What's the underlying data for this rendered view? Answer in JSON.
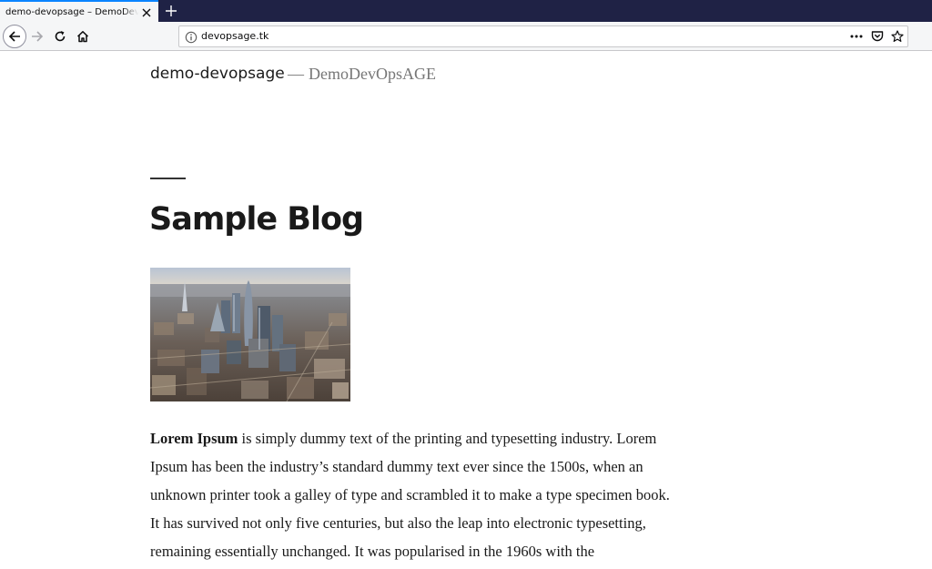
{
  "browser": {
    "tab_title": "demo-devopsage – DemoDevOpsAGE",
    "url": "devopsage.tk",
    "icons": {
      "tab_close": "close-icon",
      "new_tab": "plus-icon",
      "back": "arrow-left-icon",
      "forward": "arrow-right-icon",
      "reload": "reload-icon",
      "home": "home-icon",
      "site_info": "info-icon",
      "page_actions": "more-horizontal-icon",
      "pocket": "pocket-icon",
      "bookmark": "star-icon"
    }
  },
  "site": {
    "title": "demo-devopsage",
    "separator": "—",
    "description": "DemoDevOpsAGE"
  },
  "post": {
    "title": "Sample Blog",
    "image": "aerial-city-skyline",
    "body_bold": "Lorem Ipsum",
    "body_text": " is simply dummy text of the printing and typesetting industry. Lorem Ipsum has been the industry’s standard dummy text ever since the 1500s, when an unknown printer took a galley of type and scrambled it to make a type specimen book. It has survived not only five centuries, but also the leap into electronic typesetting, remaining essentially unchanged. It was popularised in the 1960s with the"
  },
  "colors": {
    "tabstrip": "#1f2245",
    "tab_active_border": "#0a84ff",
    "toolbar": "#f5f6f7",
    "text": "#1a1a1a",
    "muted": "#767676"
  }
}
